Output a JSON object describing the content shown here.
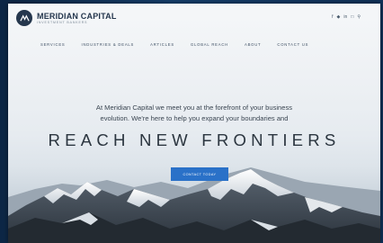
{
  "brand": {
    "name": "MERIDIAN CAPITAL",
    "tagline": "INVESTMENT BANKERS"
  },
  "social_icons": [
    "facebook-icon",
    "twitter-icon",
    "linkedin-icon",
    "instagram-icon",
    "search-icon"
  ],
  "nav": {
    "items": [
      {
        "label": "SERVICES"
      },
      {
        "label": "INDUSTRIES & DEALS"
      },
      {
        "label": "ARTICLES"
      },
      {
        "label": "GLOBAL REACH"
      },
      {
        "label": "ABOUT"
      },
      {
        "label": "CONTACT US"
      }
    ]
  },
  "hero": {
    "intro_line1": "At Meridian Capital we meet you at the forefront of your business",
    "intro_line2": "evolution. We're here to help you expand your boundaries and",
    "headline": "REACH NEW FRONTIERS",
    "cta_label": "CONTACT TODAY"
  },
  "colors": {
    "backdrop": "#10325a",
    "brand_navy": "#24364d",
    "cta_blue": "#2a71c8",
    "text_dark": "#2c3640"
  }
}
